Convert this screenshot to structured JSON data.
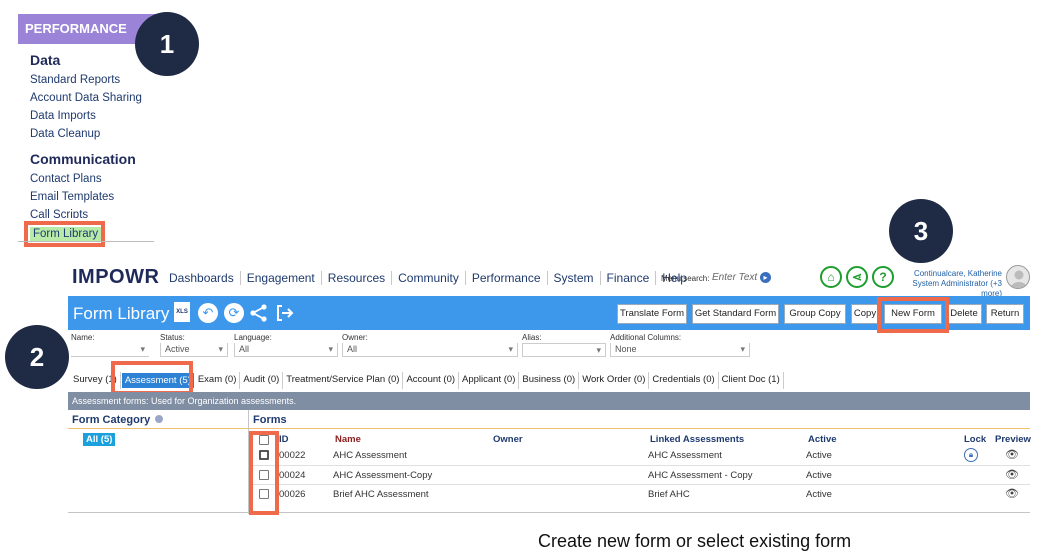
{
  "sidebar": {
    "header": "PERFORMANCE",
    "sections": [
      {
        "title": "Data",
        "links": [
          "Standard Reports",
          "Account Data Sharing",
          "Data Imports",
          "Data Cleanup"
        ]
      },
      {
        "title": "Communication",
        "links": [
          "Contact Plans",
          "Email Templates",
          "Call Scripts"
        ]
      }
    ],
    "highlighted_link": "Form Library"
  },
  "callouts": [
    "1",
    "2",
    "3"
  ],
  "app": {
    "logo": "IMPOWR",
    "nav": [
      "Dashboards",
      "Engagement",
      "Resources",
      "Community",
      "Performance",
      "System",
      "Finance",
      "Help"
    ],
    "menu_search_label": "Menu search:",
    "menu_search_placeholder": "Enter Text",
    "header_icons": [
      "home-icon",
      "share-icon",
      "help-icon"
    ],
    "user": {
      "name": "Continualcare, Katherine",
      "role": "System Administrator (+3 more)"
    },
    "page_title": "Form Library",
    "title_icons": [
      "xls-icon",
      "undo-icon",
      "refresh-icon",
      "share-icon",
      "exit-icon"
    ],
    "xls_label": "XLS",
    "toolbar": [
      "Translate Form",
      "Get Standard Form",
      "Group Copy",
      "Copy",
      "New Form",
      "Delete",
      "Return"
    ],
    "filters": {
      "name_label": "Name:",
      "status_label": "Status:",
      "status_value": "Active",
      "language_label": "Language:",
      "language_value": "All",
      "owner_label": "Owner:",
      "owner_value": "All",
      "alias_label": "Alias:",
      "addcols_label": "Additional Columns:",
      "addcols_value": "None"
    },
    "tabs": [
      "Survey (1)",
      "Assessment (5)",
      "Exam (0)",
      "Audit (0)",
      "Treatment/Service Plan (0)",
      "Account (0)",
      "Applicant (0)",
      "Business (0)",
      "Work Order (0)",
      "Credentials (0)",
      "Client Doc (1)"
    ],
    "active_tab_index": 1,
    "info_bar": "Assessment forms: Used for Organization assessments.",
    "form_category_label": "Form Category",
    "category_all": "All (5)",
    "forms_label": "Forms",
    "columns": [
      "ID",
      "Name",
      "Owner",
      "Linked Assessments",
      "Active",
      "Lock",
      "Preview"
    ],
    "rows": [
      {
        "id": "00022",
        "name": "AHC Assessment",
        "owner": "",
        "linked": "AHC Assessment",
        "active": "Active",
        "locked": true
      },
      {
        "id": "00024",
        "name": "AHC Assessment-Copy",
        "owner": "",
        "linked": "AHC Assessment - Copy",
        "active": "Active",
        "locked": false
      },
      {
        "id": "00026",
        "name": "Brief AHC Assessment",
        "owner": "",
        "linked": "Brief AHC",
        "active": "Active",
        "locked": false
      }
    ]
  },
  "caption": "Create new form or select existing form",
  "colors": {
    "accent_blue": "#3d98ec",
    "highlight_red": "#ef6a4b",
    "callout_navy": "#1f2a44",
    "perf_purple": "#9b84d8"
  }
}
